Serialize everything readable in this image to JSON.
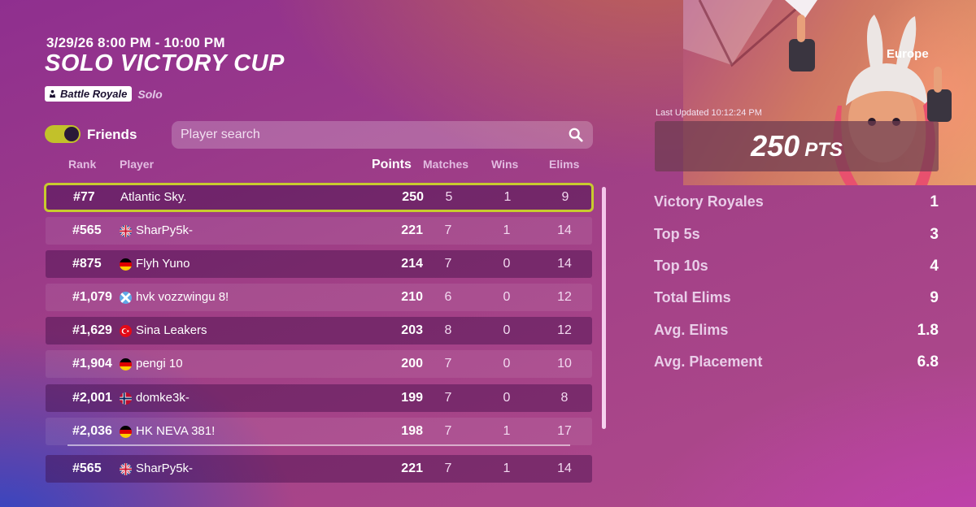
{
  "event": {
    "time": "3/29/26 8:00 PM - 10:00 PM",
    "title": "SOLO VICTORY CUP",
    "mode_badge": "Battle Royale",
    "mode_sub": "Solo"
  },
  "filters": {
    "friends_label": "Friends",
    "friends_on": true,
    "search_placeholder": "Player search"
  },
  "columns": {
    "rank": "Rank",
    "player": "Player",
    "points": "Points",
    "matches": "Matches",
    "wins": "Wins",
    "elims": "Elims"
  },
  "rows": [
    {
      "rank": "#77",
      "flag": "",
      "player": "Atlantic Sky.",
      "points": "250",
      "matches": "5",
      "wins": "1",
      "elims": "9"
    },
    {
      "rank": "#565",
      "flag": "uk-flag-icon",
      "player": "SharPy5k-",
      "points": "221",
      "matches": "7",
      "wins": "1",
      "elims": "14"
    },
    {
      "rank": "#875",
      "flag": "germany-flag-icon",
      "player": "Flyh Yuno",
      "points": "214",
      "matches": "7",
      "wins": "0",
      "elims": "14"
    },
    {
      "rank": "#1,079",
      "flag": "scotland-flag-icon",
      "player": "hvk vozzwingu 8!",
      "points": "210",
      "matches": "6",
      "wins": "0",
      "elims": "12"
    },
    {
      "rank": "#1,629",
      "flag": "turkey-flag-icon",
      "player": "Sina Leakers",
      "points": "203",
      "matches": "8",
      "wins": "0",
      "elims": "12"
    },
    {
      "rank": "#1,904",
      "flag": "germany-flag-icon",
      "player": "pengi 10",
      "points": "200",
      "matches": "7",
      "wins": "0",
      "elims": "10"
    },
    {
      "rank": "#2,001",
      "flag": "norway-flag-icon",
      "player": "domke3k-",
      "points": "199",
      "matches": "7",
      "wins": "0",
      "elims": "8"
    },
    {
      "rank": "#2,036",
      "flag": "germany-flag-icon",
      "player": "HK NEVA 381!",
      "points": "198",
      "matches": "7",
      "wins": "1",
      "elims": "17"
    }
  ],
  "pinned_row": {
    "rank": "#565",
    "flag": "uk-flag-icon",
    "player": "SharPy5k-",
    "points": "221",
    "matches": "7",
    "wins": "1",
    "elims": "14"
  },
  "summary": {
    "region": "Europe",
    "last_updated": "Last Updated 10:12:24 PM",
    "points_value": "250",
    "points_unit": "PTS",
    "stats": [
      {
        "label": "Victory Royales",
        "value": "1"
      },
      {
        "label": "Top 5s",
        "value": "3"
      },
      {
        "label": "Top 10s",
        "value": "4"
      },
      {
        "label": "Total Elims",
        "value": "9"
      },
      {
        "label": "Avg. Elims",
        "value": "1.8"
      },
      {
        "label": "Avg. Placement",
        "value": "6.8"
      }
    ]
  },
  "colors": {
    "accent_yellow": "#c8cb2e",
    "background": "#a03f86"
  }
}
